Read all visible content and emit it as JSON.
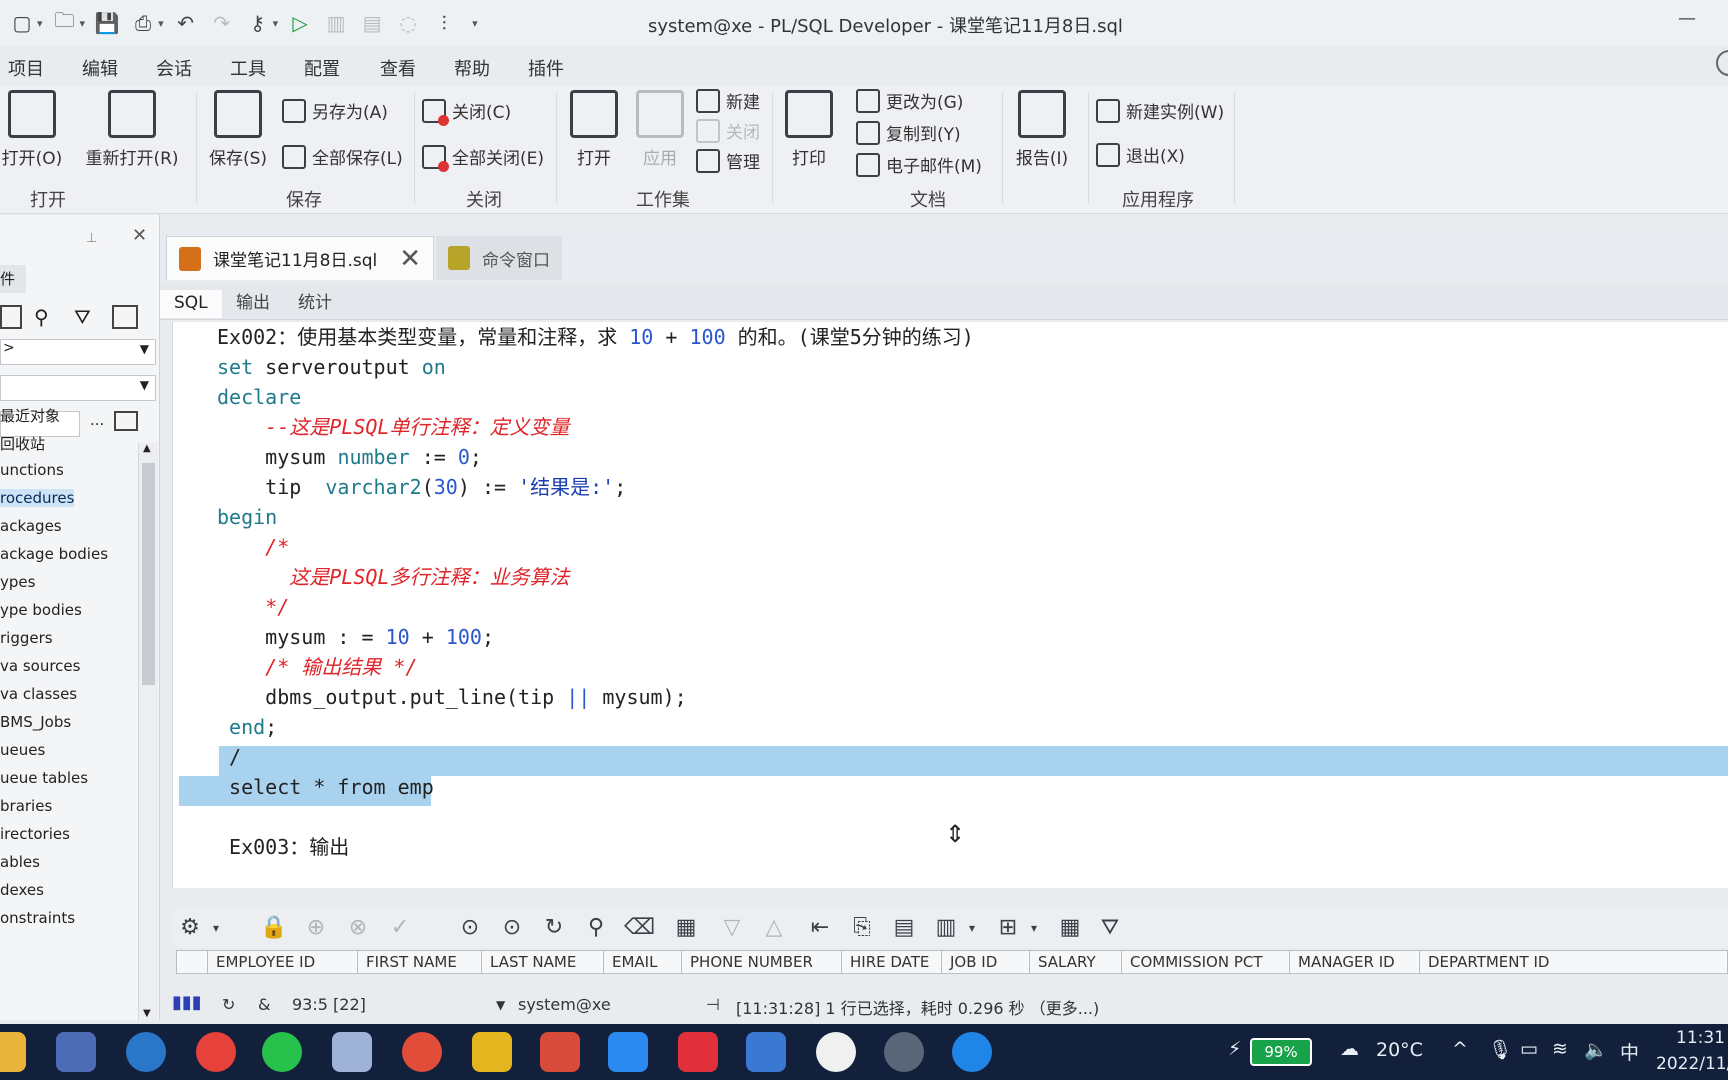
{
  "window": {
    "title": "system@xe - PL/SQL Developer - 课堂笔记11月8日.sql",
    "minimize": "—"
  },
  "menu": [
    "项目",
    "编辑",
    "会话",
    "工具",
    "配置",
    "查看",
    "帮助",
    "插件"
  ],
  "ribbon": {
    "open_group": {
      "label": "打开",
      "open": "打开(O)",
      "reopen": "重新打开(R)"
    },
    "save_group": {
      "label": "保存",
      "save": "保存(S)",
      "save_as": "另存为(A)",
      "save_all": "全部保存(L)"
    },
    "close_group": {
      "label": "关闭",
      "close": "关闭(C)",
      "close_all": "全部关闭(E)"
    },
    "workset_group": {
      "label": "工作集",
      "open": "打开",
      "apply": "应用",
      "new": "新建",
      "close": "关闭",
      "manage": "管理"
    },
    "print": "打印",
    "doc_group": {
      "label": "文档",
      "change_to": "更改为(G)",
      "copy_to": "复制到(Y)",
      "email": "电子邮件(M)"
    },
    "report": "报告(I)",
    "app_group": {
      "label": "应用程序",
      "new_instance": "新建实例(W)",
      "exit": "退出(X)"
    }
  },
  "left_panel": {
    "header_partial": "件",
    "combo1": ">",
    "combo2": "",
    "filter_dots": "...",
    "tree": [
      "最近对象",
      "回收站",
      "Functions",
      "Procedures",
      "Packages",
      "Package bodies",
      "Types",
      "Type bodies",
      "Triggers",
      "Java sources",
      "Java classes",
      "DBMS_Jobs",
      "Queues",
      "Queue tables",
      "Libraries",
      "Directories",
      "Tables",
      "Indexes",
      "Constraints"
    ],
    "tree_visible": [
      "最近对象",
      "回收站",
      "unctions",
      "rocedures",
      "ackages",
      "ackage bodies",
      "ypes",
      "ype bodies",
      "riggers",
      "va sources",
      "va classes",
      "BMS_Jobs",
      "ueues",
      "ueue tables",
      "braries",
      "irectories",
      "ables",
      "dexes",
      "onstraints"
    ],
    "selected_index": 3
  },
  "tabs": [
    {
      "label": "课堂笔记11月8日.sql",
      "active": true
    },
    {
      "label": "命令窗口",
      "active": false
    }
  ],
  "sub_tabs": [
    "SQL",
    "输出",
    "统计"
  ],
  "editor_lines": [
    "Ex002：使用基本类型变量，常量和注释，求 10 + 100 的和。(课堂5分钟的练习)",
    "set serveroutput on",
    "declare",
    "    --这是PLSQL单行注释：定义变量",
    "    mysum number := 0;",
    "    tip  varchar2(30) := '结果是:';",
    "begin",
    "    /*",
    "      这是PLSQL多行注释：业务算法",
    "    */",
    "    mysum : = 10 + 100;",
    "    /* 输出结果 */",
    "    dbms_output.put_line(tip || mysum);",
    " end;",
    " /",
    " select * from emp",
    "",
    " Ex003：输出"
  ],
  "grid_columns": [
    "EMPLOYEE ID",
    "FIRST NAME",
    "LAST NAME",
    "EMAIL",
    "PHONE NUMBER",
    "HIRE DATE",
    "JOB ID",
    "SALARY",
    "COMMISSION PCT",
    "MANAGER ID",
    "DEPARTMENT ID"
  ],
  "status": {
    "position": "93:5 [22]",
    "connection": "system@xe",
    "message": "[11:31:28] 1 行已选择，耗时 0.296 秒 （更多...)"
  },
  "taskbar": {
    "battery": "99%",
    "weather": "20°C",
    "ime": "中",
    "time": "11:31",
    "date": "2022/11/"
  }
}
